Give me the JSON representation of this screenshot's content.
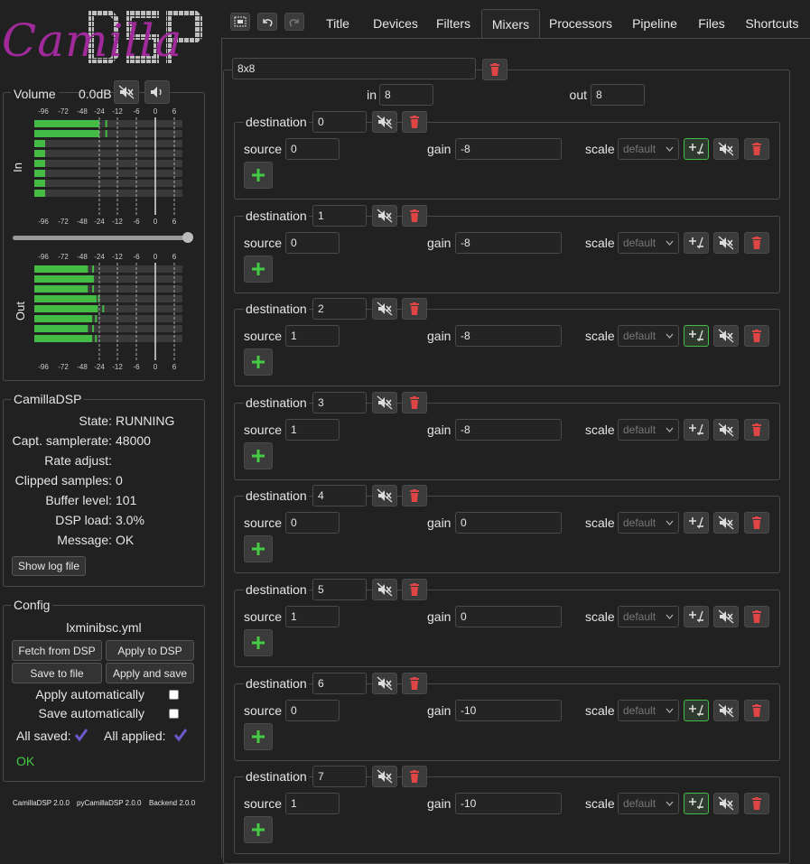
{
  "logo": {
    "text_script": "Camilla",
    "text_block": "DSP"
  },
  "toolbar": {
    "icons": [
      "select-icon",
      "undo-icon",
      "redo-icon"
    ]
  },
  "tabs": [
    "Title",
    "Devices",
    "Filters",
    "Mixers",
    "Processors",
    "Pipeline",
    "Files",
    "Shortcuts"
  ],
  "active_tab": "Mixers",
  "volume": {
    "label": "Volume",
    "value": "0.0dB",
    "in_label": "In",
    "out_label": "Out",
    "ticks": [
      "-96",
      "-72",
      "-48",
      "-24",
      "-12",
      "-6",
      "0",
      "6"
    ],
    "in_levels_db": [
      -24,
      -24,
      -96,
      -96,
      -96,
      -96,
      -96,
      -96
    ],
    "in_peaks_db": [
      -20,
      -20,
      -96,
      -96,
      -96,
      -96,
      -96,
      -96
    ],
    "out_levels_db": [
      -40,
      -34,
      -40,
      -28,
      -26,
      -34,
      -40,
      -34
    ],
    "out_peaks_db": [
      -34,
      -34,
      -34,
      -26,
      -22,
      -30,
      -34,
      -30
    ],
    "slider_fraction": 1.0
  },
  "status": {
    "title": "CamillaDSP",
    "rows": [
      {
        "label": "State:",
        "value": "RUNNING"
      },
      {
        "label": "Capt. samplerate:",
        "value": "48000"
      },
      {
        "label": "Rate adjust:",
        "value": ""
      },
      {
        "label": "Clipped samples:",
        "value": "0"
      },
      {
        "label": "Buffer level:",
        "value": "101"
      },
      {
        "label": "DSP load:",
        "value": "3.0%"
      },
      {
        "label": "Message:",
        "value": "OK"
      }
    ],
    "show_log": "Show log file"
  },
  "config": {
    "title": "Config",
    "filename": "lxminibsc.yml",
    "fetch": "Fetch from DSP",
    "apply": "Apply to DSP",
    "save": "Save to file",
    "apply_save": "Apply and save",
    "apply_auto": "Apply automatically",
    "save_auto": "Save automatically",
    "all_saved": "All saved:",
    "all_applied": "All applied:",
    "ok": "OK"
  },
  "versions": {
    "camilladsp": "CamillaDSP 2.0.0",
    "pycamilladsp": "pyCamillaDSP 2.0.0",
    "backend": "Backend 2.0.0"
  },
  "mixer": {
    "name": "8x8",
    "in_label": "in",
    "in_value": "8",
    "out_label": "out",
    "out_value": "8",
    "dest_label": "destination",
    "source_label": "source",
    "gain_label": "gain",
    "scale_label": "scale",
    "scale_value": "default",
    "destinations": [
      {
        "dest": "0",
        "source": "0",
        "gain": "-8",
        "inverted": true
      },
      {
        "dest": "1",
        "source": "0",
        "gain": "-8",
        "inverted": false
      },
      {
        "dest": "2",
        "source": "1",
        "gain": "-8",
        "inverted": true
      },
      {
        "dest": "3",
        "source": "1",
        "gain": "-8",
        "inverted": false
      },
      {
        "dest": "4",
        "source": "0",
        "gain": "0",
        "inverted": false
      },
      {
        "dest": "5",
        "source": "1",
        "gain": "0",
        "inverted": false
      },
      {
        "dest": "6",
        "source": "0",
        "gain": "-10",
        "inverted": true
      },
      {
        "dest": "7",
        "source": "1",
        "gain": "-10",
        "inverted": true
      }
    ]
  },
  "colors": {
    "accent": "#44bb44",
    "delete": "#e04545",
    "logo_purple": "#a02a9a",
    "check": "#6a5acd",
    "ok": "#44cc44"
  }
}
